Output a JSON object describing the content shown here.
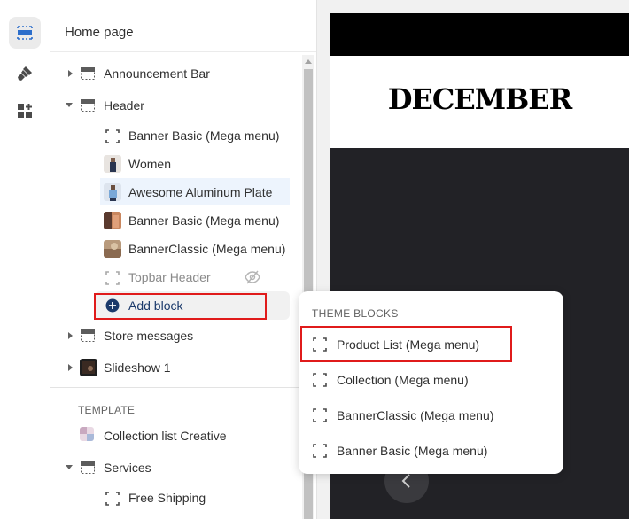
{
  "panel": {
    "title": "Home page"
  },
  "sections": [
    {
      "label": "Announcement Bar",
      "expanded": false
    },
    {
      "label": "Header",
      "expanded": true
    },
    {
      "label": "Store messages",
      "expanded": false
    },
    {
      "label": "Slideshow 1",
      "expanded": false
    }
  ],
  "header_blocks": [
    {
      "label": "Banner Basic (Mega menu)",
      "icon": "dashed-square-icon"
    },
    {
      "label": "Women",
      "icon": "image-thumb"
    },
    {
      "label": "Awesome Aluminum Plate",
      "icon": "image-thumb",
      "highlighted": true
    },
    {
      "label": "Banner Basic (Mega menu)",
      "icon": "image-thumb"
    },
    {
      "label": "BannerClassic (Mega menu)",
      "icon": "image-thumb"
    },
    {
      "label": "Topbar Header",
      "icon": "dashed-square-icon",
      "hidden": true
    }
  ],
  "add_block": {
    "label": "Add block"
  },
  "template": {
    "heading": "TEMPLATE",
    "items": [
      {
        "label": "Collection list Creative",
        "expanded": false
      },
      {
        "label": "Services",
        "expanded": true
      }
    ],
    "services_blocks": [
      {
        "label": "Free Shipping"
      }
    ]
  },
  "popup": {
    "heading": "THEME BLOCKS",
    "items": [
      {
        "label": "Product List (Mega menu)"
      },
      {
        "label": "Collection (Mega menu)"
      },
      {
        "label": "BannerClassic (Mega menu)"
      },
      {
        "label": "Banner Basic (Mega menu)"
      }
    ]
  },
  "preview": {
    "logo": "DECEMBER"
  },
  "colors": {
    "highlight": "#edf4fd",
    "red_outline": "#e01b1b",
    "add_icon": "#1b3a6b"
  }
}
